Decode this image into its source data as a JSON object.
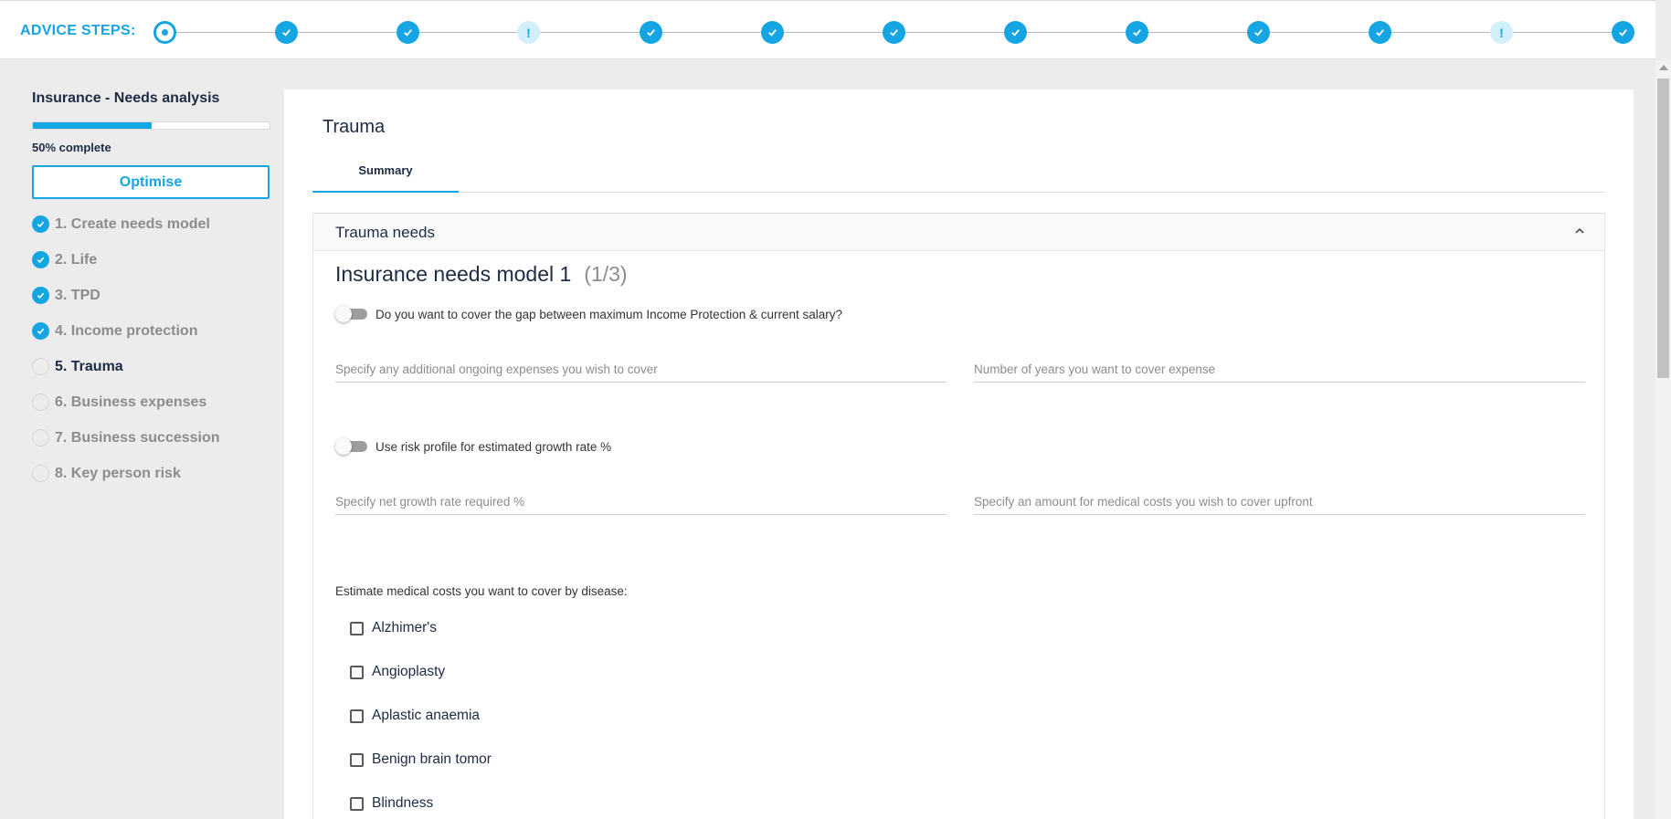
{
  "steps": {
    "label": "ADVICE STEPS:",
    "items": [
      {
        "state": "current",
        "glyph": ""
      },
      {
        "state": "done",
        "glyph": ""
      },
      {
        "state": "done",
        "glyph": ""
      },
      {
        "state": "warn",
        "glyph": "!"
      },
      {
        "state": "done",
        "glyph": ""
      },
      {
        "state": "done",
        "glyph": ""
      },
      {
        "state": "done",
        "glyph": ""
      },
      {
        "state": "done",
        "glyph": ""
      },
      {
        "state": "done",
        "glyph": ""
      },
      {
        "state": "done",
        "glyph": ""
      },
      {
        "state": "done",
        "glyph": ""
      },
      {
        "state": "warn",
        "glyph": "!"
      },
      {
        "state": "done",
        "glyph": ""
      }
    ]
  },
  "sidebar": {
    "title": "Insurance - Needs analysis",
    "progress_fraction": 0.5,
    "progress_text": "50% complete",
    "optimise_label": "Optimise",
    "items": [
      {
        "label": "1. Create needs model",
        "checked": true,
        "active": false
      },
      {
        "label": "2. Life",
        "checked": true,
        "active": false
      },
      {
        "label": "3. TPD",
        "checked": true,
        "active": false
      },
      {
        "label": "4. Income protection",
        "checked": true,
        "active": false
      },
      {
        "label": "5. Trauma",
        "checked": false,
        "active": true
      },
      {
        "label": "6. Business expenses",
        "checked": false,
        "active": false
      },
      {
        "label": "7. Business succession",
        "checked": false,
        "active": false
      },
      {
        "label": "8. Key person risk",
        "checked": false,
        "active": false
      }
    ]
  },
  "main": {
    "title": "Trauma",
    "tabs": [
      {
        "label": "Summary"
      }
    ],
    "card": {
      "header": "Trauma needs",
      "model_title": "Insurance needs model 1",
      "model_count": "(1/3)",
      "toggle_gap_label": "Do you want to cover the gap between maximum Income Protection & current salary?",
      "toggle_risk_label": "Use risk profile for estimated growth rate %",
      "fields": {
        "ongoing_expenses_placeholder": "Specify any additional ongoing expenses you wish to cover",
        "years_placeholder": "Number of years you want to cover expense",
        "growth_rate_placeholder": "Specify net growth rate required %",
        "medical_upfront_placeholder": "Specify an amount for medical costs you wish to cover upfront"
      },
      "disease_label": "Estimate medical costs you want to cover by disease:",
      "diseases": [
        "Alzhimer's",
        "Angioplasty",
        "Aplastic anaemia",
        "Benign brain tomor",
        "Blindness"
      ]
    }
  },
  "colors": {
    "accent": "#16a5e3",
    "warn_bg": "#d2effc",
    "text_dark": "#1d2b44",
    "text_muted": "#8c8c8c"
  },
  "icons": {
    "step_done": "check-icon",
    "step_warn": "exclamation-icon",
    "step_current": "current-step-icon",
    "nav_checked": "check-circle-icon",
    "nav_empty": "empty-circle-icon",
    "card_collapse": "chevron-up-icon",
    "scroll_up": "scroll-up-arrow-icon"
  }
}
